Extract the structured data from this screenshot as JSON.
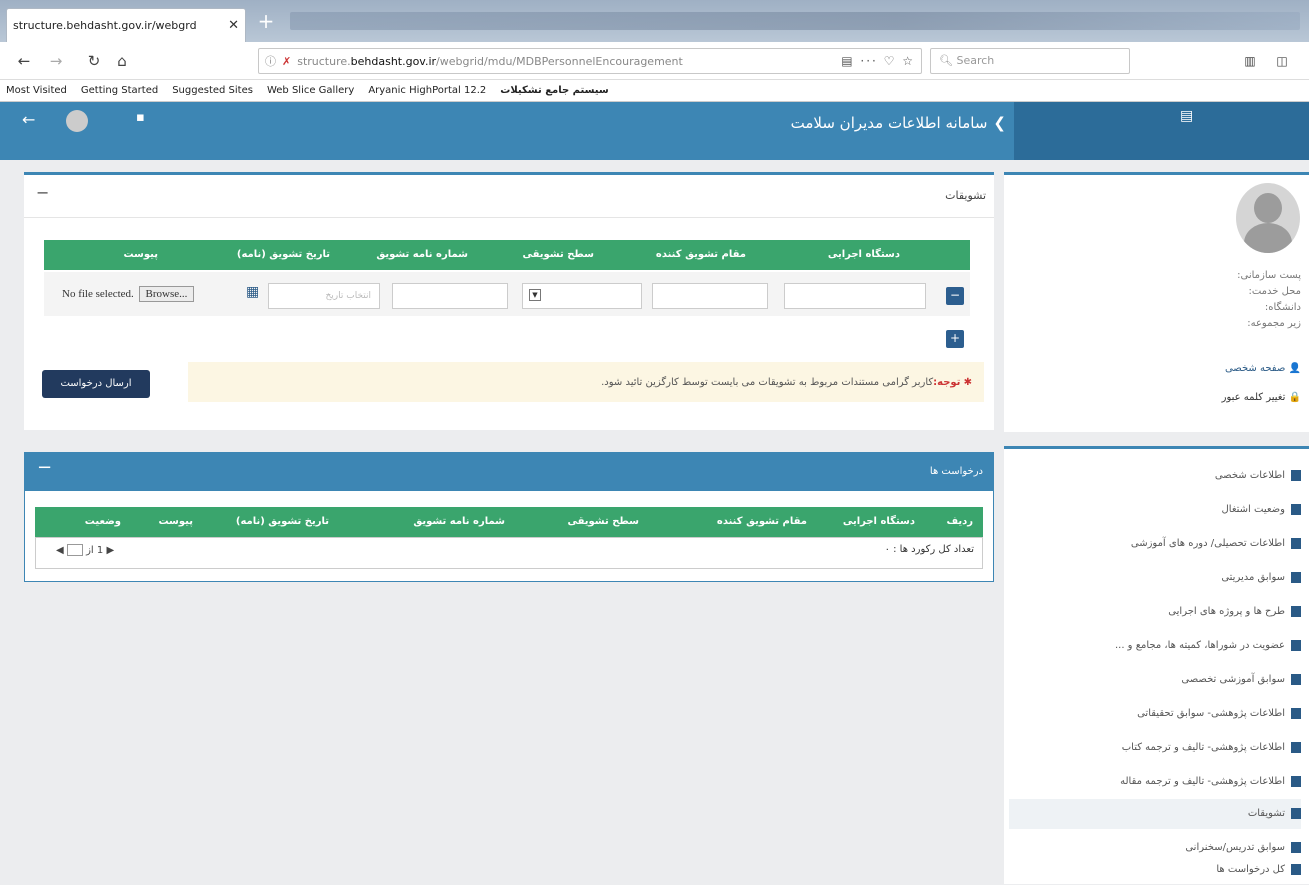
{
  "browser": {
    "tab_title": "structure.behdasht.gov.ir/webgrd",
    "tab_close": "✕",
    "new_tab": "+",
    "url_prefix": "ⓘ",
    "url_plain": "structure.",
    "url_domain": "behdasht.gov.ir",
    "url_path": "/webgrid/mdu/MDBPersonnelEncouragement",
    "url_actions": "▤ ··· ♡ ☆",
    "search_placeholder": "Search",
    "bookmarks": [
      "Most Visited",
      "Getting Started",
      "Suggested Sites",
      "Web Slice Gallery",
      "Aryanic HighPortal 12.2",
      "سیستم جامع تشکیلات"
    ]
  },
  "header": {
    "title": "سامانه اطلاعات مدیران سلامت",
    "back_icon": "←",
    "chevron": "❯"
  },
  "sidebar": {
    "info": [
      "پست سازمانی:",
      "محل خدمت:",
      "دانشگاه:",
      "زیر مجموعه:"
    ],
    "links": [
      "صفحه شخصی",
      "تغییر کلمه عبور"
    ],
    "menu": [
      "اطلاعات شخصی",
      "وضعیت اشتغال",
      "اطلاعات تحصیلی/ دوره های آموزشی",
      "سوابق مدیریتی",
      "طرح ها و پروژه های اجرایی",
      "عضویت در شوراها، کمیته ها، مجامع و ...",
      "سوابق آموزشی تخصصی",
      "اطلاعات پژوهشی- سوابق تحقیقاتی",
      "اطلاعات پژوهشی- تالیف و ترجمه کتاب",
      "اطلاعات پژوهشی- تالیف و ترجمه مقاله",
      "تشویقات",
      "سوابق تدریس/سخنرانی",
      "کل درخواست ها"
    ]
  },
  "panel1": {
    "title": "تشویقات",
    "minimize": "−",
    "columns": [
      "دستگاه اجرایی",
      "مقام تشویق کننده",
      "سطح تشویقی",
      "شماره نامه تشویق",
      "تاریخ تشویق (نامه)",
      "پیوست"
    ],
    "date_placeholder": "انتخاب تاریخ",
    "browse_label": "Browse...",
    "no_file": "No file selected.",
    "notice_bold": "توجه:",
    "notice_text": "کاربر گرامی مستندات مربوط به تشویقات می بایست توسط کارگزین تائید شود.",
    "send_button": "ارسال درخواست"
  },
  "panel2": {
    "title": "درخواست ها",
    "minimize": "−",
    "columns": [
      "ردیف",
      "دستگاه اجرایی",
      "مقام تشویق کننده",
      "سطح تشویقی",
      "شماره نامه تشویق",
      "تاریخ تشویق (نامه)",
      "پیوست",
      "وضعیت"
    ],
    "total_label": "تعداد کل رکورد ها : ۰",
    "pager_of": "از",
    "pager_total": "1"
  }
}
